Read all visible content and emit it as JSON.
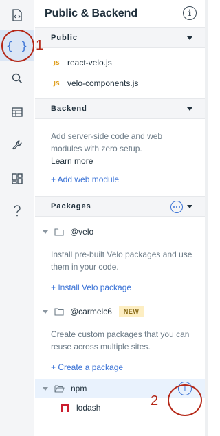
{
  "rail": {
    "items": [
      {
        "name": "page-code-icon"
      },
      {
        "name": "public-backend-icon",
        "glyph": "{ }",
        "active": true
      },
      {
        "name": "search-icon"
      },
      {
        "name": "databases-icon"
      },
      {
        "name": "developer-tools-icon"
      },
      {
        "name": "packages-icon"
      },
      {
        "name": "help-icon"
      }
    ]
  },
  "header": {
    "title": "Public & Backend",
    "info_glyph": "i"
  },
  "public": {
    "label": "Public",
    "files": [
      {
        "badge": "JS",
        "name": "react-velo.js"
      },
      {
        "badge": "JS",
        "name": "velo-components.js"
      }
    ]
  },
  "backend": {
    "label": "Backend",
    "description": "Add server-side code and web modules with zero setup.",
    "learn_more": "Learn more",
    "add_link": "+ Add web module"
  },
  "packages": {
    "label": "Packages",
    "velo": {
      "name": "@velo",
      "description": "Install pre-built Velo packages and use them in your code.",
      "link": "+ Install Velo package"
    },
    "custom": {
      "name": "@carmelc6",
      "badge": "NEW",
      "description": "Create custom packages that you can reuse across multiple sites.",
      "link": "+ Create a package"
    },
    "npm": {
      "name": "npm",
      "add_glyph": "+"
    },
    "installed": [
      {
        "name": "lodash"
      }
    ]
  },
  "annotations": {
    "first": "1",
    "second": "2"
  },
  "colors": {
    "accent": "#3b73d6",
    "annotation": "#b52818",
    "js_badge": "#e0a020",
    "lodash": "#cb1e2e"
  }
}
